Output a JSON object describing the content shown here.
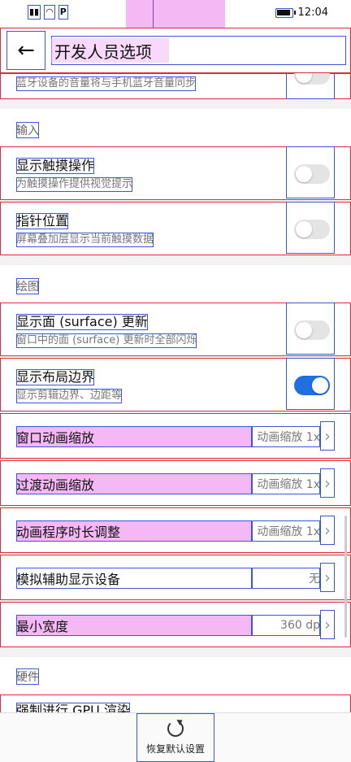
{
  "status_bar": {
    "indicators": [
      "signal-icon",
      "wifi-icon",
      "parking-icon"
    ],
    "time": "12:04"
  },
  "header": {
    "title": "开发人员选项"
  },
  "rows": {
    "bluetooth_volume_sub": "蓝牙设备的音量将与手机蓝牙音量同步",
    "section_input": "输入",
    "show_touches": {
      "title": "显示触摸操作",
      "summary": "为触摸操作提供视觉提示",
      "enabled": false
    },
    "pointer_location": {
      "title": "指针位置",
      "summary": "屏幕叠加层显示当前触摸数据",
      "enabled": false
    },
    "section_drawing": "绘图",
    "show_surface_updates": {
      "title": "显示面 (surface) 更新",
      "summary": "窗口中的面 (surface) 更新时全部闪烁",
      "enabled": false
    },
    "show_layout_bounds": {
      "title": "显示布局边界",
      "summary": "显示剪辑边界、边距等",
      "enabled": true
    },
    "window_animation_scale": {
      "title": "窗口动画缩放",
      "value": "动画缩放 1x"
    },
    "transition_animation_scale": {
      "title": "过渡动画缩放",
      "value": "动画缩放 1x"
    },
    "animator_duration_scale": {
      "title": "动画程序时长调整",
      "value": "动画缩放 1x"
    },
    "simulate_secondary_displays": {
      "title": "模拟辅助显示设备",
      "value": "无"
    },
    "smallest_width": {
      "title": "最小宽度",
      "value": "360 dp"
    },
    "section_hardware": "硬件",
    "force_gpu_rendering": {
      "title": "强制进行 GPU 渲染"
    }
  },
  "bottom": {
    "reset_label": "恢复默认设置"
  },
  "colors": {
    "accent": "#1f6fe0",
    "overlay_red": "#e2283a",
    "overlay_blue": "#3a57d6",
    "overlay_pink": "#f4b9f4"
  }
}
